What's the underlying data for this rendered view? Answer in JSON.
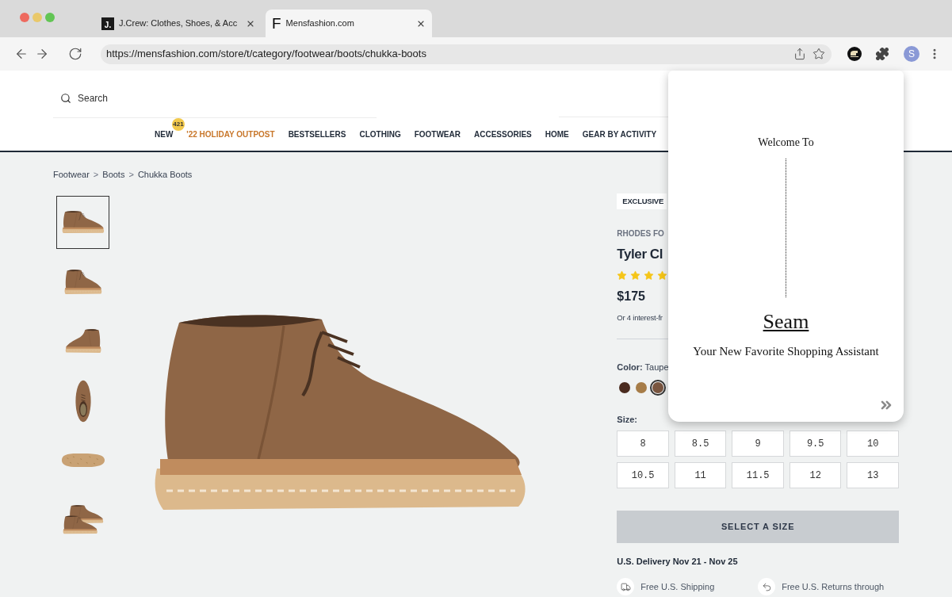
{
  "browser": {
    "tabs": [
      {
        "favicon": {
          "kind": "tile",
          "text": "J."
        },
        "title": "J.Crew: Clothes, Shoes, & Acc",
        "selected": false
      },
      {
        "favicon": {
          "kind": "letter",
          "text": "F"
        },
        "title": "Mensfashion.com",
        "selected": true
      }
    ],
    "url": "https://mensfashion.com/store/t/category/footwear/boots/chukka-boots",
    "profile_initial": "S"
  },
  "header": {
    "search": {
      "placeholder": "Search"
    },
    "nav": [
      {
        "label": "NEW",
        "badge": "421",
        "highlighted": false
      },
      {
        "label": "'22 HOLIDAY OUTPOST",
        "highlighted": true
      },
      {
        "label": "BESTSELLERS",
        "highlighted": false
      },
      {
        "label": "CLOTHING",
        "highlighted": false
      },
      {
        "label": "FOOTWEAR",
        "highlighted": false
      },
      {
        "label": "ACCESSORIES",
        "highlighted": false
      },
      {
        "label": "HOME",
        "highlighted": false
      },
      {
        "label": "GEAR BY ACTIVITY",
        "highlighted": false
      }
    ]
  },
  "breadcrumb": [
    {
      "kind": "link",
      "text": "Footwear"
    },
    {
      "kind": "separator",
      "text": ">"
    },
    {
      "kind": "link",
      "text": "Boots"
    },
    {
      "kind": "separator",
      "text": ">"
    },
    {
      "kind": "link",
      "text": "Chukka Boots"
    }
  ],
  "gallery": {
    "thumbnails": [
      {
        "kind": "side",
        "selected": true
      },
      {
        "kind": "front",
        "selected": false
      },
      {
        "kind": "back",
        "selected": false
      },
      {
        "kind": "top",
        "selected": false
      },
      {
        "kind": "sole",
        "selected": false
      },
      {
        "kind": "pair",
        "selected": false
      }
    ]
  },
  "product": {
    "badge": "EXCLUSIVE",
    "brand": "RHODES FO",
    "title": "Tyler Cl",
    "stars": 4,
    "price": "$175",
    "installments": "Or 4 interest-fr",
    "color_label": "**Color:** Taupe",
    "swatches": [
      {
        "color": "#4a2b1f",
        "selected": false
      },
      {
        "color": "#a67c48",
        "selected": false
      },
      {
        "color": "#7a5640",
        "selected": true
      }
    ],
    "size_label": "Size:",
    "sizes": [
      {
        "label": "8",
        "selected": false
      },
      {
        "label": "8.5",
        "selected": false
      },
      {
        "label": "9",
        "selected": false
      },
      {
        "label": "9.5",
        "selected": false
      },
      {
        "label": "10",
        "selected": false
      },
      {
        "label": "10.5",
        "selected": false
      },
      {
        "label": "11",
        "selected": false
      },
      {
        "label": "11.5",
        "selected": false
      },
      {
        "label": "12",
        "selected": false
      },
      {
        "label": "13",
        "selected": false
      }
    ],
    "cta": "SELECT A SIZE",
    "delivery": "U.S. Delivery Nov 21 - Nov 25",
    "perks": [
      {
        "kind": "shipping",
        "text": "Free U.S. Shipping"
      },
      {
        "kind": "returns",
        "text": "Free U.S. Returns through"
      }
    ]
  },
  "assistant_popup": {
    "greeting": "Welcome To",
    "name": "Seam",
    "tagline": "Your New Favorite Shopping Assistant"
  }
}
